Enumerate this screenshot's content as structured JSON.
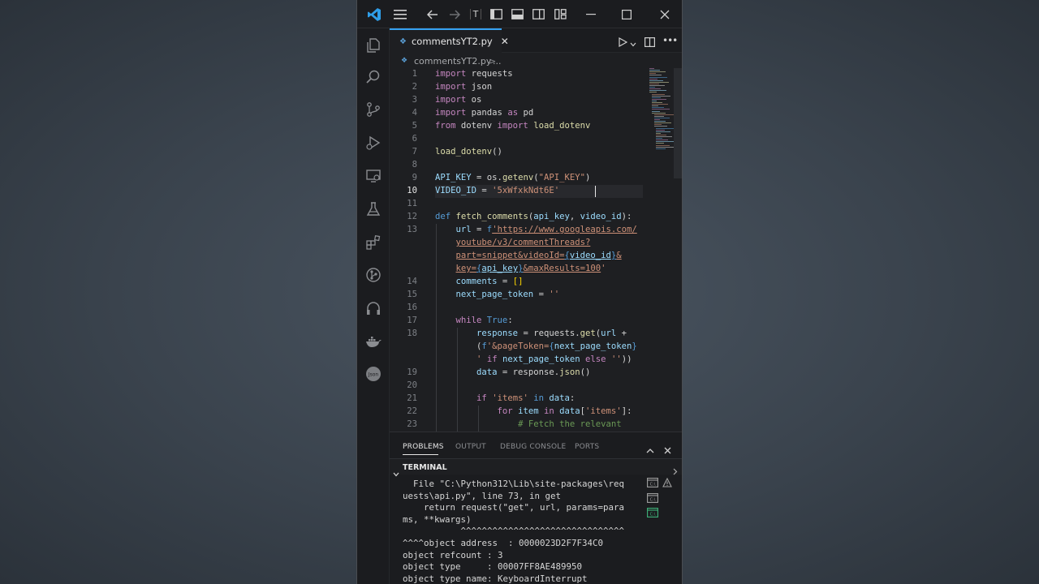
{
  "titlebar": {
    "layout_toggle_label": "T"
  },
  "tab": {
    "filename": "commentsYT2.py",
    "icon": "python-icon"
  },
  "breadcrumb": {
    "file": "commentsYT2.py",
    "separator": ">",
    "more": "..."
  },
  "editor": {
    "active_line": 10,
    "lines": [
      {
        "n": "1",
        "html": "<span class='kw'>import</span> requests"
      },
      {
        "n": "2",
        "html": "<span class='kw'>import</span> json"
      },
      {
        "n": "3",
        "html": "<span class='kw'>import</span> os"
      },
      {
        "n": "4",
        "html": "<span class='kw'>import</span> pandas <span class='kw'>as</span> pd"
      },
      {
        "n": "5",
        "html": "<span class='kw'>from</span> dotenv <span class='kw'>import</span> <span class='fn'>load_dotenv</span>"
      },
      {
        "n": "6",
        "html": ""
      },
      {
        "n": "7",
        "html": "<span class='fn'>load_dotenv</span>()"
      },
      {
        "n": "8",
        "html": ""
      },
      {
        "n": "9",
        "html": "<span class='var'>API_KEY</span> = os.<span class='fn'>getenv</span>(<span class='str'>\"API_KEY\"</span>)"
      },
      {
        "n": "10",
        "html": "<span class='var'>VIDEO_ID</span> = <span class='str'>'5xWfxkNdt6E'</span>"
      },
      {
        "n": "11",
        "html": ""
      },
      {
        "n": "12",
        "html": "<span class='kb'>def</span> <span class='fn'>fetch_comments</span>(<span class='var'>api_key</span>, <span class='var'>video_id</span>):"
      },
      {
        "n": "13",
        "html": "    <span class='var'>url</span> = <span class='kb'>f</span><span class='str url'>'https://www.googleapis.com/</span>"
      },
      {
        "n": "",
        "html": "    <span class='str url'>youtube/v3/commentThreads?</span>"
      },
      {
        "n": "",
        "html": "    <span class='str url'>part=snippet&amp;videoId=</span><span class='kb url'>{</span><span class='var url'>video_id</span><span class='kb url'>}</span><span class='str url'>&amp;</span>"
      },
      {
        "n": "",
        "html": "    <span class='str url'>key=</span><span class='kb url'>{</span><span class='var url'>api_key</span><span class='kb url'>}</span><span class='str url'>&amp;maxResults=100</span><span class='str'>'</span>"
      },
      {
        "n": "14",
        "html": "    <span class='var'>comments</span> = <span class='brk'>[]</span>"
      },
      {
        "n": "15",
        "html": "    <span class='var'>next_page_token</span> = <span class='str'>''</span>"
      },
      {
        "n": "16",
        "html": ""
      },
      {
        "n": "17",
        "html": "    <span class='kw'>while</span> <span class='kb'>True</span>:"
      },
      {
        "n": "18",
        "html": "        <span class='var'>response</span> = requests.<span class='fn'>get</span>(<span class='var'>url</span> +"
      },
      {
        "n": "",
        "html": "        (<span class='kb'>f</span><span class='str'>'&amp;pageToken=</span><span class='kb'>{</span><span class='var'>next_page_token</span><span class='kb'>}</span>"
      },
      {
        "n": "",
        "html": "        <span class='str'>'</span> <span class='kw'>if</span> <span class='var'>next_page_token</span> <span class='kw'>else</span> <span class='str'>''</span>))"
      },
      {
        "n": "19",
        "html": "        <span class='var'>data</span> = response.<span class='fn'>json</span>()"
      },
      {
        "n": "20",
        "html": ""
      },
      {
        "n": "21",
        "html": "        <span class='kw'>if</span> <span class='str'>'items'</span> <span class='kb'>in</span> <span class='var'>data</span>:"
      },
      {
        "n": "22",
        "html": "            <span class='kw'>for</span> <span class='var'>item</span> <span class='kw'>in</span> <span class='var'>data</span>[<span class='str'>'items'</span>]:"
      },
      {
        "n": "23",
        "html": "                <span class='cmt'># Fetch the relevant</span>"
      }
    ]
  },
  "panel": {
    "tabs": [
      "PROBLEMS",
      "OUTPUT",
      "DEBUG CONSOLE",
      "PORTS"
    ],
    "active_tab": "PROBLEMS",
    "section_label": "TERMINAL"
  },
  "terminal": {
    "lines": [
      "  File \"C:\\Python312\\Lib\\site-packages\\req",
      "uests\\api.py\", line 73, in get",
      "    return request(\"get\", url, params=para",
      "ms, **kwargs)",
      "           ^^^^^^^^^^^^^^^^^^^^^^^^^^^^^^^",
      "^^^^object address  : 0000023D2F7F34C0",
      "object refcount : 3",
      "object type     : 00007FF8AE489950",
      "object type name: KeyboardInterrupt"
    ]
  },
  "colors": {
    "accent": "#35a1f2",
    "background": "#1e1f22"
  }
}
